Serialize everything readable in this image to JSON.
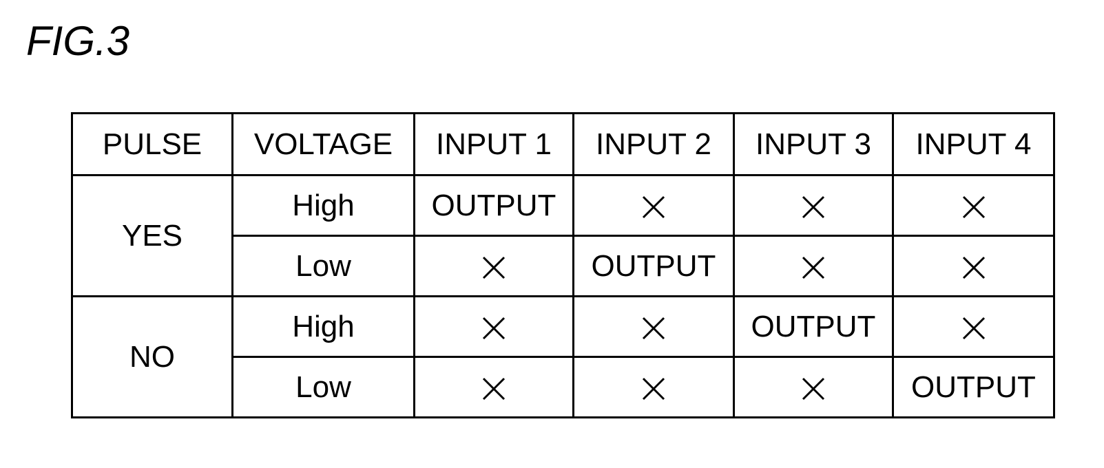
{
  "figure": {
    "title": "FIG.3"
  },
  "table": {
    "headers": [
      "PULSE",
      "VOLTAGE",
      "INPUT 1",
      "INPUT 2",
      "INPUT 3",
      "INPUT 4"
    ],
    "groups": [
      {
        "pulse": "YES",
        "rows": [
          {
            "voltage": "High",
            "cells": [
              "OUTPUT",
              "×",
              "×",
              "×"
            ]
          },
          {
            "voltage": "Low",
            "cells": [
              "×",
              "OUTPUT",
              "×",
              "×"
            ]
          }
        ]
      },
      {
        "pulse": "NO",
        "rows": [
          {
            "voltage": "High",
            "cells": [
              "×",
              "×",
              "OUTPUT",
              "×"
            ]
          },
          {
            "voltage": "Low",
            "cells": [
              "×",
              "×",
              "×",
              "OUTPUT"
            ]
          }
        ]
      }
    ],
    "symbols": {
      "output": "OUTPUT",
      "no_output": "×",
      "no_output_icon": "x-mark-icon"
    }
  }
}
